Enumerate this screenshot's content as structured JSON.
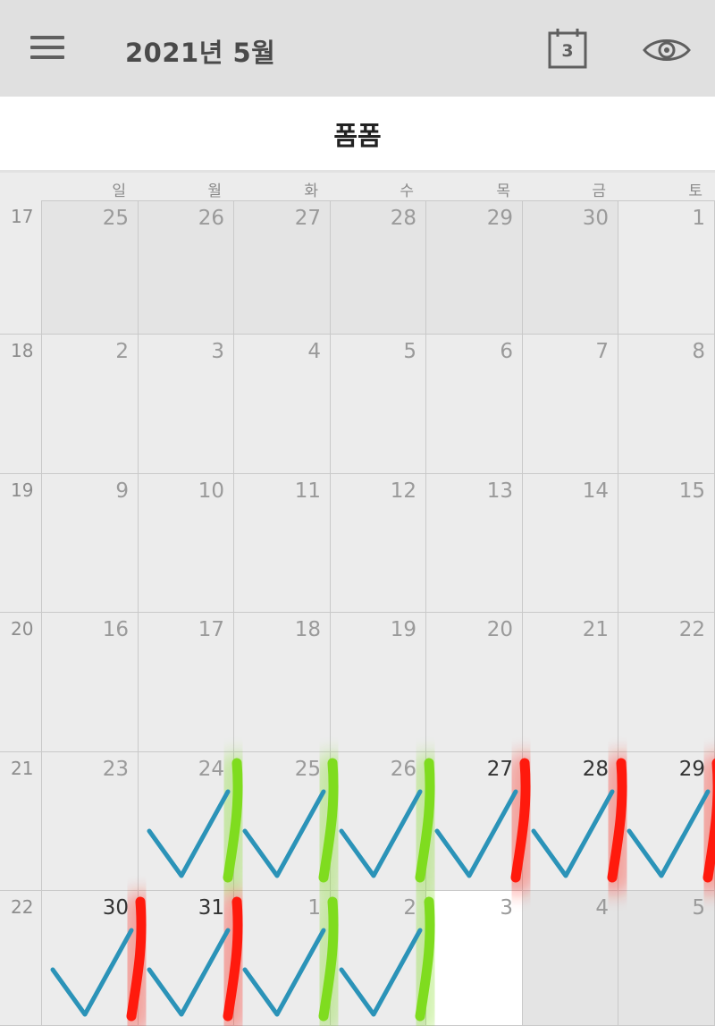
{
  "header": {
    "month_title": "2021년 5월",
    "today_badge": "3"
  },
  "calendar_name": "폼폼",
  "weekdays": [
    "일",
    "월",
    "화",
    "수",
    "목",
    "금",
    "토"
  ],
  "weeks": [
    {
      "week": "17",
      "days": [
        {
          "n": "25",
          "bg": "#e4e4e4",
          "dark": false
        },
        {
          "n": "26",
          "bg": "#e4e4e4",
          "dark": false
        },
        {
          "n": "27",
          "bg": "#e4e4e4",
          "dark": false
        },
        {
          "n": "28",
          "bg": "#e4e4e4",
          "dark": false
        },
        {
          "n": "29",
          "bg": "#e4e4e4",
          "dark": false
        },
        {
          "n": "30",
          "bg": "#e4e4e4",
          "dark": false
        },
        {
          "n": "1",
          "bg": "#ececec",
          "dark": false
        }
      ]
    },
    {
      "week": "18",
      "days": [
        {
          "n": "2",
          "bg": "#ececec",
          "dark": false
        },
        {
          "n": "3",
          "bg": "#ececec",
          "dark": false
        },
        {
          "n": "4",
          "bg": "#ececec",
          "dark": false
        },
        {
          "n": "5",
          "bg": "#ececec",
          "dark": false
        },
        {
          "n": "6",
          "bg": "#ececec",
          "dark": false
        },
        {
          "n": "7",
          "bg": "#ececec",
          "dark": false
        },
        {
          "n": "8",
          "bg": "#ececec",
          "dark": false
        }
      ]
    },
    {
      "week": "19",
      "days": [
        {
          "n": "9",
          "bg": "#ececec",
          "dark": false
        },
        {
          "n": "10",
          "bg": "#ececec",
          "dark": false
        },
        {
          "n": "11",
          "bg": "#ececec",
          "dark": false
        },
        {
          "n": "12",
          "bg": "#ececec",
          "dark": false
        },
        {
          "n": "13",
          "bg": "#ececec",
          "dark": false
        },
        {
          "n": "14",
          "bg": "#ececec",
          "dark": false
        },
        {
          "n": "15",
          "bg": "#ececec",
          "dark": false
        }
      ]
    },
    {
      "week": "20",
      "days": [
        {
          "n": "16",
          "bg": "#ececec",
          "dark": false
        },
        {
          "n": "17",
          "bg": "#ececec",
          "dark": false
        },
        {
          "n": "18",
          "bg": "#ececec",
          "dark": false
        },
        {
          "n": "19",
          "bg": "#ececec",
          "dark": false
        },
        {
          "n": "20",
          "bg": "#ececec",
          "dark": false
        },
        {
          "n": "21",
          "bg": "#ececec",
          "dark": false
        },
        {
          "n": "22",
          "bg": "#ececec",
          "dark": false
        }
      ]
    },
    {
      "week": "21",
      "days": [
        {
          "n": "23",
          "bg": "#ececec",
          "dark": false
        },
        {
          "n": "24",
          "bg": "#ececec",
          "dark": false
        },
        {
          "n": "25",
          "bg": "#ececec",
          "dark": false
        },
        {
          "n": "26",
          "bg": "#ececec",
          "dark": false
        },
        {
          "n": "27",
          "bg": "#ececec",
          "dark": true
        },
        {
          "n": "28",
          "bg": "#ececec",
          "dark": true
        },
        {
          "n": "29",
          "bg": "#ececec",
          "dark": true
        }
      ]
    },
    {
      "week": "22",
      "days": [
        {
          "n": "30",
          "bg": "#ececec",
          "dark": true
        },
        {
          "n": "31",
          "bg": "#ececec",
          "dark": true
        },
        {
          "n": "1",
          "bg": "#ececec",
          "dark": false
        },
        {
          "n": "2",
          "bg": "#ececec",
          "dark": false
        },
        {
          "n": "3",
          "bg": "#ffffff",
          "dark": false
        },
        {
          "n": "4",
          "bg": "#e4e4e4",
          "dark": false
        },
        {
          "n": "5",
          "bg": "#e4e4e4",
          "dark": false
        }
      ]
    }
  ],
  "icons": {
    "menu": "hamburger-menu-icon",
    "today": "calendar-today-icon",
    "view": "eye-icon"
  },
  "colors": {
    "check": "#2b93b8",
    "green": "#7fdc1f",
    "red": "#ff1a0d",
    "header_bg": "#e0e0e0"
  }
}
